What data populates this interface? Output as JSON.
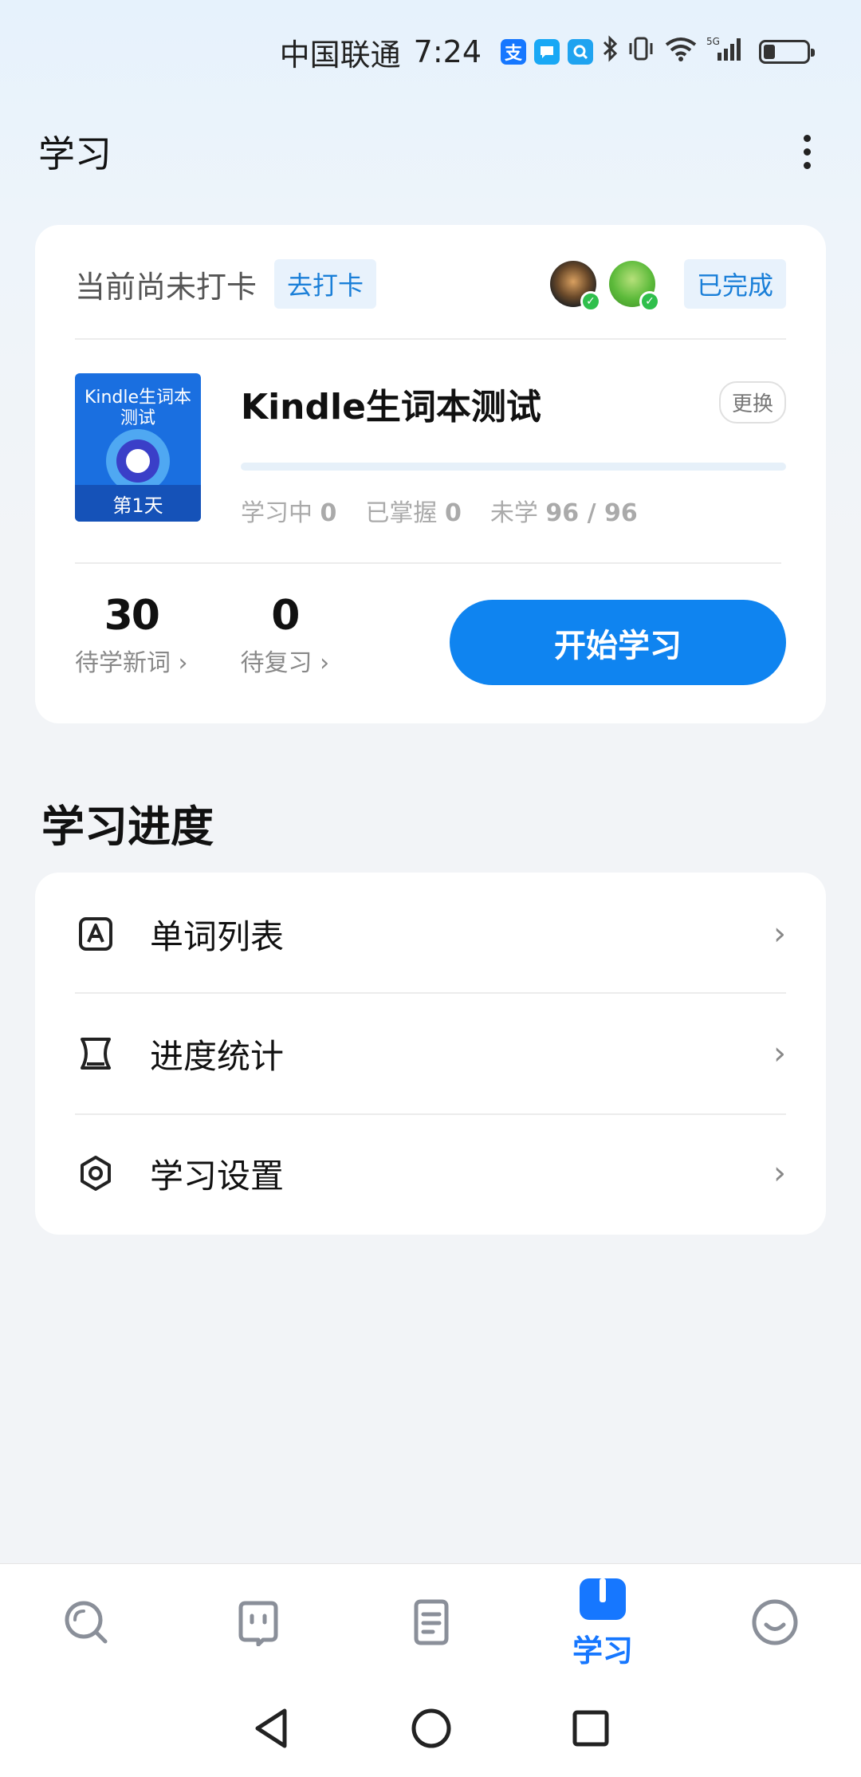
{
  "status_bar": {
    "carrier": "中国联通",
    "time": "7:24",
    "app_icons": [
      "alipay-icon",
      "chat-bubble-icon",
      "search-app-icon"
    ],
    "network": "5G",
    "battery_level": 0.35
  },
  "header": {
    "title": "学习",
    "more_icon": "more-vertical-icon"
  },
  "checkin": {
    "status_text": "当前尚未打卡",
    "action_label": "去打卡",
    "done_label": "已完成"
  },
  "book": {
    "cover_title": "Kindle生词本测试",
    "cover_day": "第1天",
    "name": "Kindle生词本测试",
    "change_label": "更换",
    "progress": 0,
    "stats": {
      "learning_label": "学习中",
      "learning_value": "0",
      "mastered_label": "已掌握",
      "mastered_value": "0",
      "unlearned_label": "未学",
      "unlearned_value": "96 / 96"
    }
  },
  "counts": {
    "new_words_value": "30",
    "new_words_label": "待学新词 ›",
    "review_value": "0",
    "review_label": "待复习 ›"
  },
  "start_button": "开始学习",
  "progress_section": {
    "title": "学习进度",
    "items": [
      {
        "label": "单词列表",
        "icon": "word-list-icon"
      },
      {
        "label": "进度统计",
        "icon": "hourglass-icon"
      },
      {
        "label": "学习设置",
        "icon": "settings-hexagon-icon"
      }
    ]
  },
  "bottom_nav": {
    "items": [
      {
        "icon": "search-nav-icon",
        "label": ""
      },
      {
        "icon": "chat-nav-icon",
        "label": ""
      },
      {
        "icon": "notes-nav-icon",
        "label": ""
      },
      {
        "icon": "study-book-icon",
        "label": "学习",
        "active": true
      },
      {
        "icon": "profile-smile-icon",
        "label": ""
      }
    ]
  },
  "colors": {
    "accent": "#0f84f0",
    "tag_bg": "#e8f2fc",
    "tag_text": "#1a7fd8"
  }
}
